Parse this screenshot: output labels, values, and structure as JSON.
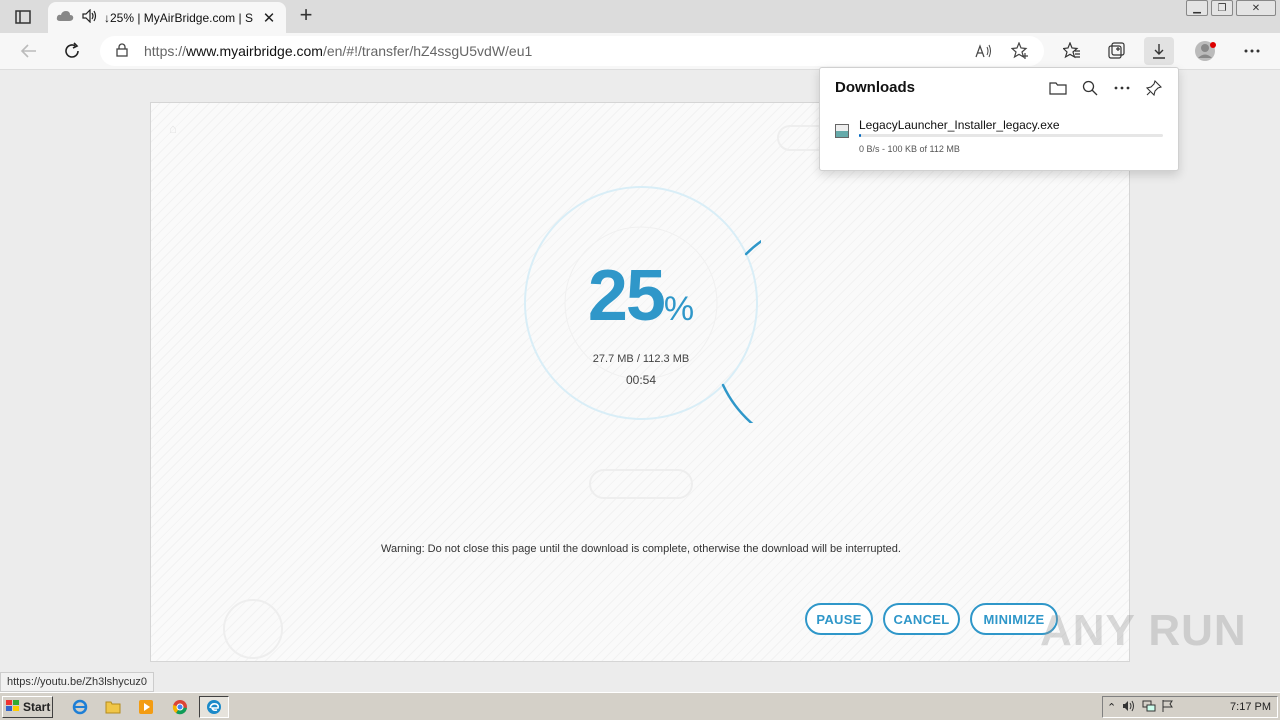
{
  "browser": {
    "tab_title": "↓25% | MyAirBridge.com | S",
    "url_prefix": "https://",
    "url_host": "www.myairbridge.com",
    "url_path": "/en/#!/transfer/hZ4ssgU5vdW/eu1",
    "status_link": "https://youtu.be/Zh3lshycuz0"
  },
  "transfer": {
    "percent": "25",
    "percent_sign": "%",
    "progress_fraction": 0.25,
    "sizes": "27.7 MB / 112.3 MB",
    "eta": "00:54",
    "warning": "Warning: Do not close this page until the download is complete, otherwise the download will be interrupted.",
    "buttons": {
      "pause": "PAUSE",
      "cancel": "CANCEL",
      "minimize": "MINIMIZE"
    },
    "accent_color": "#2f97c9"
  },
  "downloads": {
    "title": "Downloads",
    "item": {
      "filename": "LegacyLauncher_Installer_legacy.exe",
      "status": "0 B/s - 100 KB of 112 MB",
      "progress_fraction": 0.001
    }
  },
  "taskbar": {
    "start": "Start",
    "clock": "7:17 PM"
  },
  "watermark": "ANY RUN"
}
